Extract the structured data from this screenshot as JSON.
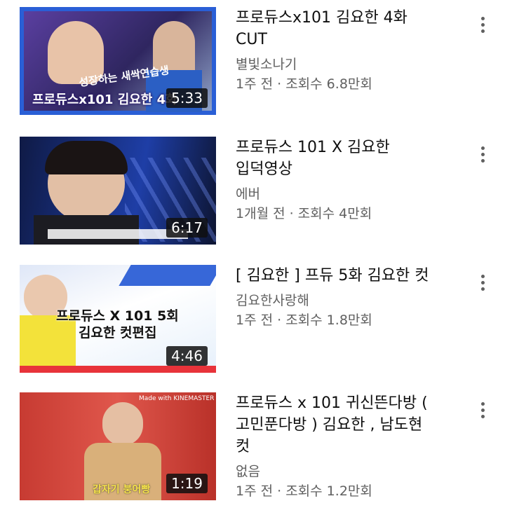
{
  "videos": [
    {
      "title": "프로듀스x101 김요한 4화\nCUT",
      "channel": "별빛소나기",
      "stats": "1주 전 · 조회수 6.8만회",
      "duration": "5:33",
      "thumb_caption": "프로듀스x101 김요한 4화",
      "thumb_subcaption": "성장하는 새싹연습생",
      "thumb_colors": {
        "bg": "#3a2a6e",
        "frame": "#2a5fd6"
      }
    },
    {
      "title": "프로듀스  101 X 김요한\n입덕영상",
      "channel": "에버",
      "stats": "1개월 전 · 조회수 4만회",
      "duration": "6:17",
      "thumb_colors": {
        "bg": "#1b2a66",
        "accent": "#3b5bd9"
      }
    },
    {
      "title": "[ 김요한 ] 프듀 5화 김요한 컷",
      "channel": "김요한사랑해",
      "stats": "1주 전 · 조회수 1.8만회",
      "duration": "4:46",
      "thumb_caption": "프로듀스 X 101 5회",
      "thumb_subcaption": "김요한 컷편집",
      "thumb_colors": {
        "bg": "#ffffff",
        "accent": "#e8333a",
        "shirt": "#f3e23a"
      }
    },
    {
      "title": "프로듀스 x 101 귀신뜬다방 (\n고민푼다방 ) 김요한 , 남도현\n컷",
      "channel": "없음",
      "stats": "1주 전 · 조회수 1.2만회",
      "duration": "1:19",
      "thumb_caption": "갑자기 붕어빵",
      "thumb_corner": "Made with KINEMASTER",
      "thumb_colors": {
        "bg": "#d8443a",
        "sweater": "#d9b07a"
      }
    }
  ],
  "icons": {
    "more": "more-vertical-icon"
  }
}
